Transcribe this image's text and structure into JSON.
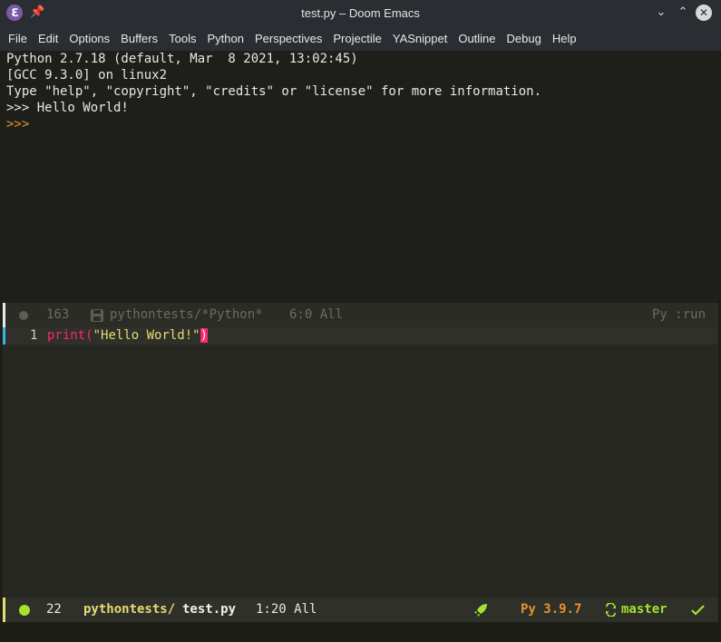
{
  "window": {
    "title": "test.py – Doom Emacs",
    "icons": [
      "emacs-logo-icon",
      "pin-icon",
      "minimize-icon",
      "maximize-icon",
      "close-icon"
    ]
  },
  "menu": [
    "File",
    "Edit",
    "Options",
    "Buffers",
    "Tools",
    "Python",
    "Perspectives",
    "Projectile",
    "YASnippet",
    "Outline",
    "Debug",
    "Help"
  ],
  "repl": {
    "lines": [
      "Python 2.7.18 (default, Mar  8 2021, 13:02:45)",
      "[GCC 9.3.0] on linux2",
      "Type \"help\", \"copyright\", \"credits\" or \"license\" for more information.",
      ">>> Hello World!"
    ],
    "prompt": ">>>"
  },
  "repl_modeline": {
    "line_count": "163",
    "buffer": "pythontests/*Python*",
    "position": "6:0 All",
    "mode": "Py :run"
  },
  "editor": {
    "line_number": "1",
    "code_fn": "print",
    "code_open": "(",
    "code_string": "\"Hello World!\"",
    "code_close": ")"
  },
  "file_modeline": {
    "line_count": "22",
    "dir": "pythontests/",
    "file": "test.py",
    "position": "1:20 All",
    "python_version": "Py 3.9.7",
    "branch": "master"
  },
  "colors": {
    "background": "#272822",
    "keyword": "#f92672",
    "string": "#e6db74",
    "ok": "#a6e22e",
    "prompt": "#e6922c",
    "line-marker": "#40b4e0"
  }
}
